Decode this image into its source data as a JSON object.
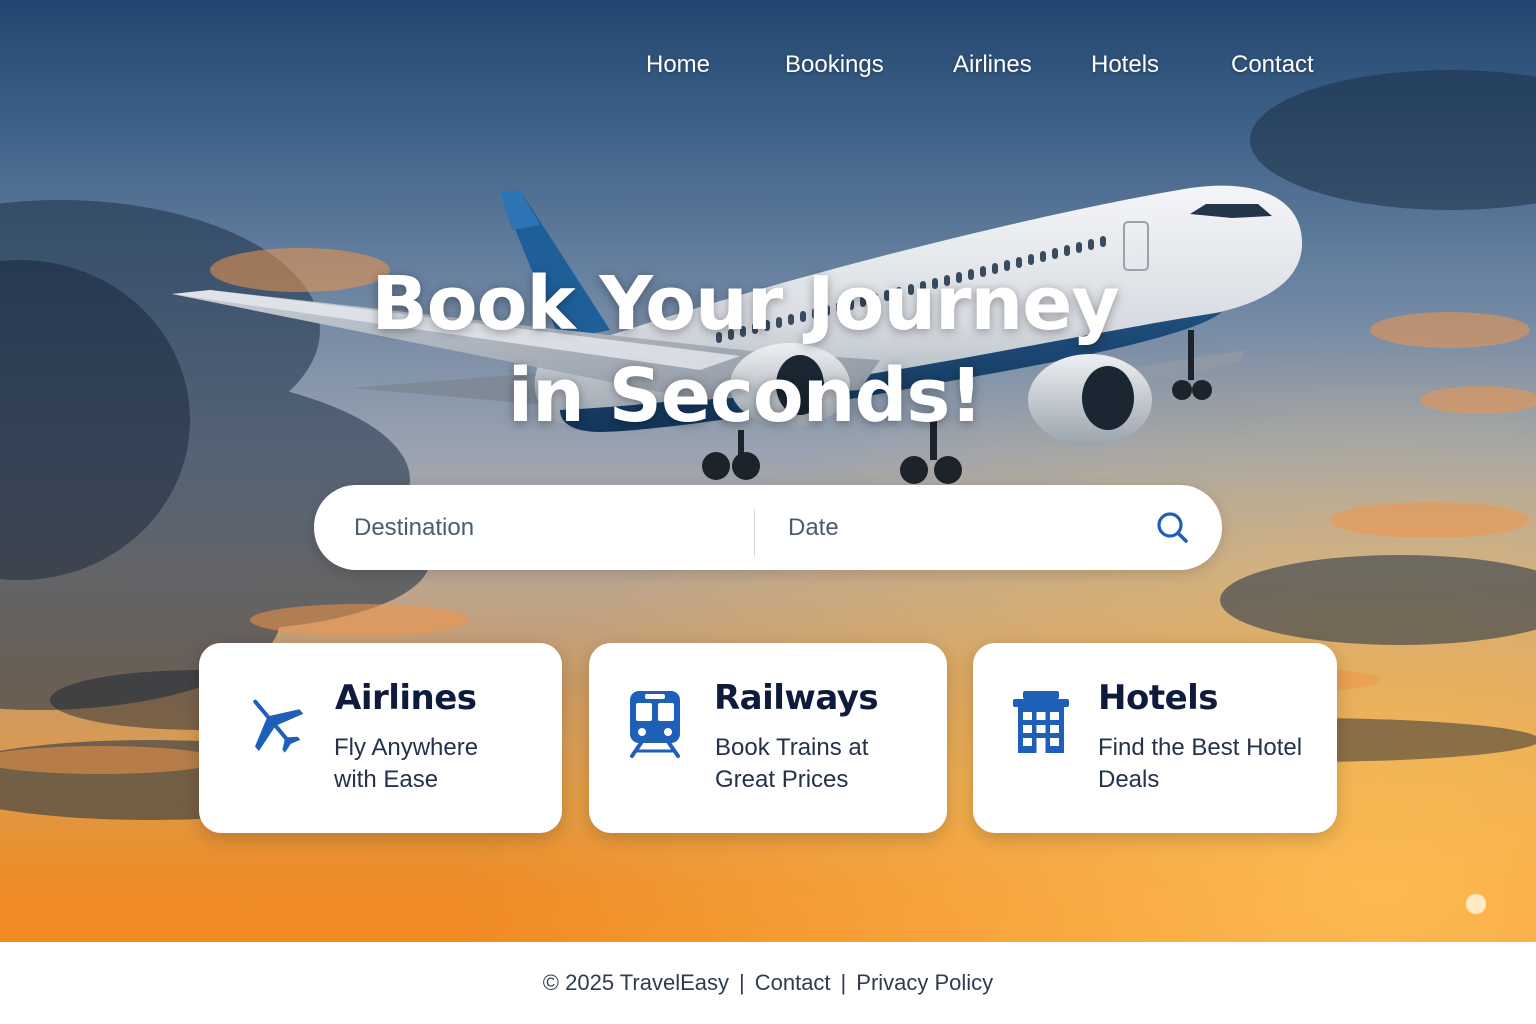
{
  "nav": {
    "items": [
      {
        "label": "Home"
      },
      {
        "label": "Bookings"
      },
      {
        "label": "Airlines"
      },
      {
        "label": "Hotels"
      },
      {
        "label": "Contact"
      }
    ]
  },
  "hero": {
    "headline_line1": "Book Your Journey",
    "headline_line2": "in Seconds!"
  },
  "search": {
    "destination_placeholder": "Destination",
    "date_placeholder": "Date",
    "search_icon": "search-icon"
  },
  "cards": [
    {
      "title": "Airlines",
      "desc_line1": "Fly Anywhere",
      "desc_line2": "with Ease",
      "icon": "airplane-icon"
    },
    {
      "title": "Railways",
      "desc_line1": "Book Trains at",
      "desc_line2": "Great Prices",
      "icon": "train-icon"
    },
    {
      "title": "Hotels",
      "desc_line1": "Find the Best Hotel",
      "desc_line2": "Deals",
      "icon": "hotel-building-icon"
    }
  ],
  "footer": {
    "copyright": "© 2025 TravelEasy",
    "separator": "|",
    "contact_link": "Contact",
    "privacy_link": "Privacy Policy"
  },
  "colors": {
    "accent_blue": "#1e5fb8",
    "card_title": "#0f1b3d",
    "sky_top": "#22466f",
    "sunset_orange": "#f28a22"
  }
}
